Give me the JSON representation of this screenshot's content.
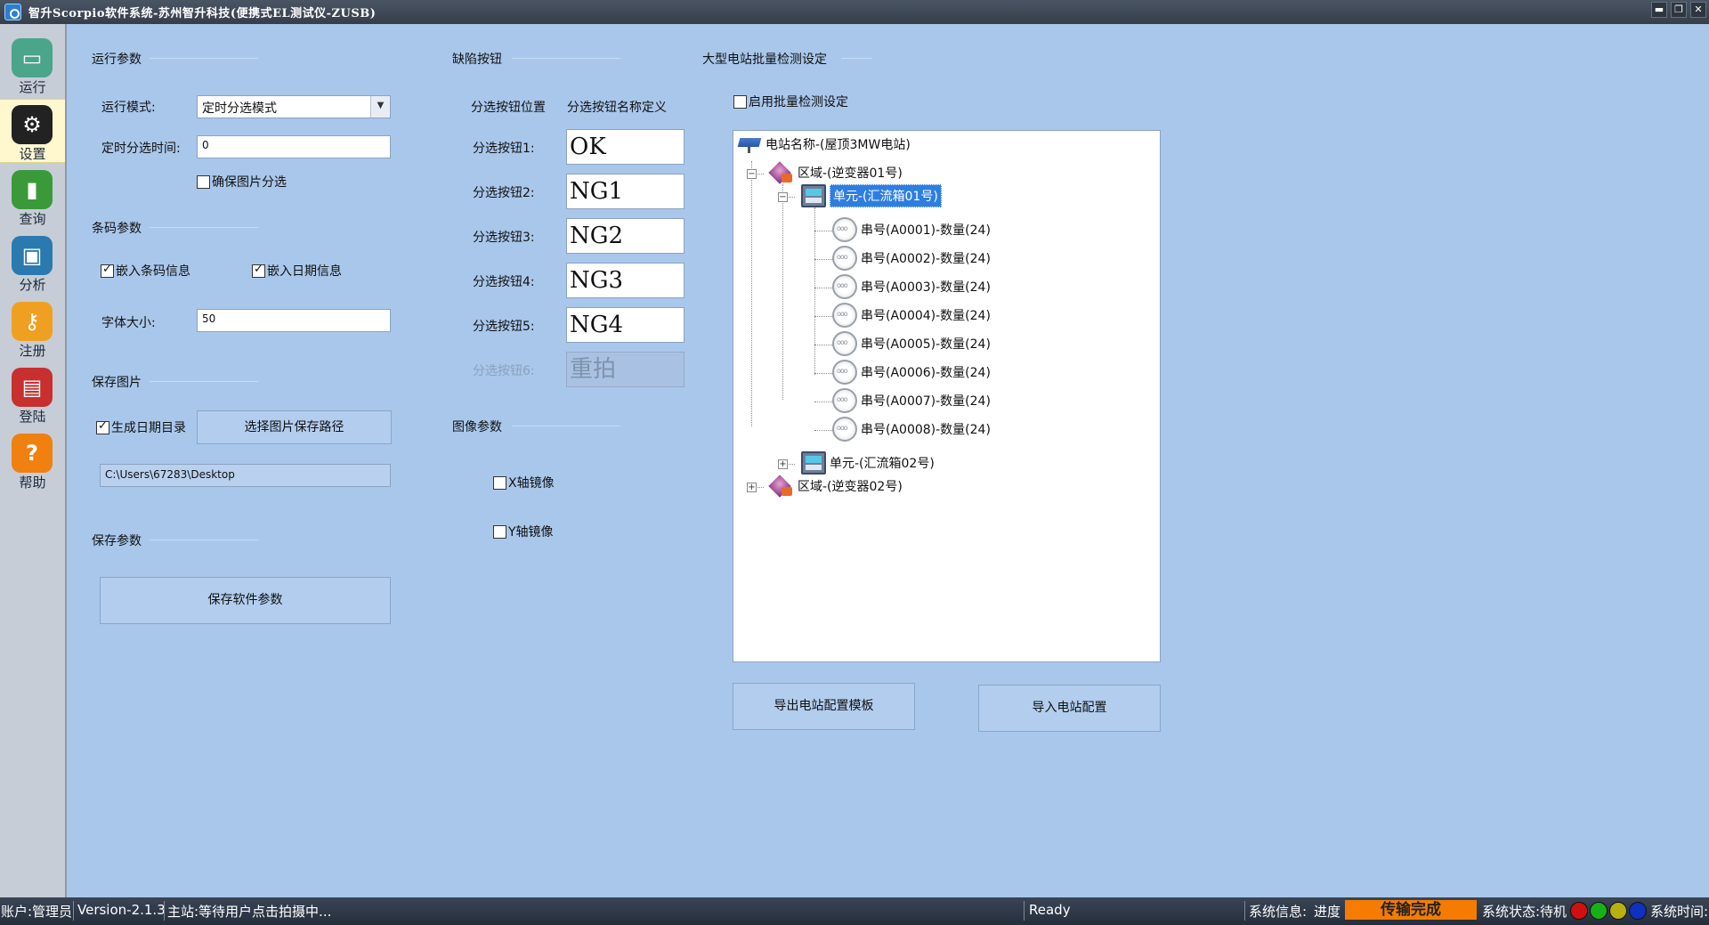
{
  "window": {
    "title": "智升Scorpio软件系统-苏州智升科技(便携式EL测试仪-ZUSB)",
    "minimize": "▬",
    "restore": "❐",
    "close": "✕"
  },
  "sidebar": {
    "items": [
      {
        "label": "运行",
        "icon": "monitor-icon",
        "glyph": "▭",
        "color": "#4aa58a"
      },
      {
        "label": "设置",
        "icon": "gear-icon",
        "glyph": "⚙",
        "color": "#222222"
      },
      {
        "label": "查询",
        "icon": "bar-chart-icon",
        "glyph": "▮",
        "color": "#3a9a3a"
      },
      {
        "label": "分析",
        "icon": "windows-monitor-icon",
        "glyph": "▣",
        "color": "#2a7ab0"
      },
      {
        "label": "注册",
        "icon": "key-icon",
        "glyph": "⚷",
        "color": "#f0a020"
      },
      {
        "label": "登陆",
        "icon": "user-card-icon",
        "glyph": "▤",
        "color": "#c83030"
      },
      {
        "label": "帮助",
        "icon": "help-icon",
        "glyph": "?",
        "color": "#f08010"
      }
    ],
    "active_index": 1
  },
  "run_params": {
    "title": "运行参数",
    "mode_label": "运行模式:",
    "mode_value": "定时分选模式",
    "timer_label": "定时分选时间:",
    "timer_value": "0",
    "ensure_image_label": "确保图片分选",
    "ensure_image_checked": false
  },
  "barcode_params": {
    "title": "条码参数",
    "embed_barcode_label": "嵌入条码信息",
    "embed_barcode_checked": true,
    "embed_date_label": "嵌入日期信息",
    "embed_date_checked": true,
    "font_size_label": "字体大小:",
    "font_size_value": "50"
  },
  "save_image": {
    "title": "保存图片",
    "date_dir_label": "生成日期目录",
    "date_dir_checked": true,
    "choose_path_button": "选择图片保存路径",
    "path_value": "C:\\Users\\67283\\Desktop"
  },
  "save_params": {
    "title": "保存参数",
    "save_button": "保存软件参数"
  },
  "defect_buttons": {
    "title": "缺陷按钮",
    "col_position": "分选按钮位置",
    "col_name": "分选按钮名称定义",
    "rows": [
      {
        "label": "分选按钮1:",
        "value": "OK",
        "enabled": true
      },
      {
        "label": "分选按钮2:",
        "value": "NG1",
        "enabled": true
      },
      {
        "label": "分选按钮3:",
        "value": "NG2",
        "enabled": true
      },
      {
        "label": "分选按钮4:",
        "value": "NG3",
        "enabled": true
      },
      {
        "label": "分选按钮5:",
        "value": "NG4",
        "enabled": true
      },
      {
        "label": "分选按钮6:",
        "value": "重拍",
        "enabled": false
      }
    ]
  },
  "image_params": {
    "title": "图像参数",
    "x_mirror_label": "X轴镜像",
    "x_mirror_checked": false,
    "y_mirror_label": "Y轴镜像",
    "y_mirror_checked": false
  },
  "batch": {
    "title": "大型电站批量检测设定",
    "enable_label": "启用批量检测设定",
    "enable_checked": false,
    "tree": {
      "station": "电站名称-(屋顶3MW电站)",
      "area1": "区域-(逆变器01号)",
      "unit1": "单元-(汇流箱01号)",
      "strings": [
        "串号(A0001)-数量(24)",
        "串号(A0002)-数量(24)",
        "串号(A0003)-数量(24)",
        "串号(A0004)-数量(24)",
        "串号(A0005)-数量(24)",
        "串号(A0006)-数量(24)",
        "串号(A0007)-数量(24)",
        "串号(A0008)-数量(24)"
      ],
      "unit2": "单元-(汇流箱02号)",
      "area2": "区域-(逆变器02号)"
    },
    "export_button": "导出电站配置模板",
    "import_button": "导入电站配置"
  },
  "statusbar": {
    "account": "账户:管理员",
    "version": "Version-2.1.3",
    "main_status": "主站:等待用户点击拍摄中...",
    "ready": "Ready",
    "sys_info": "系统信息:",
    "progress_label": "进度",
    "progress_text": "传输完成",
    "sys_state": "系统状态:待机",
    "sys_time": "系统时间:",
    "led_colors": [
      "#d01010",
      "#18b018",
      "#b8b010",
      "#1030c0"
    ]
  }
}
